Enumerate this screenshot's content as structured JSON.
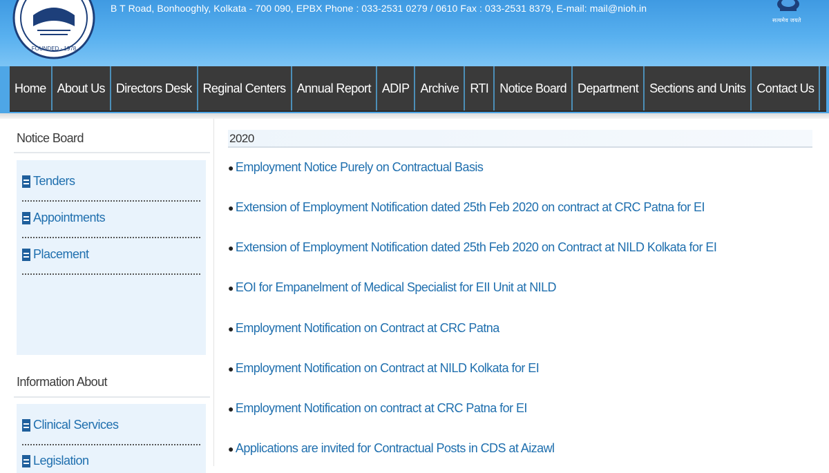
{
  "header": {
    "address": "B T Road, Bonhooghly, Kolkata - 700 090, EPBX Phone : 033-2531 0279 / 0610 Fax : 033-2531 8379, E-mail: mail@nioh.in",
    "logo_icon": "institute-seal-icon",
    "emblem_icon": "government-emblem-icon",
    "logo_text": "FOUNDED - 1978",
    "emblem_text": "सत्यमेव जयते",
    "colors": {
      "header_top": "#3f9ae2",
      "header_bottom": "#7cc4f5"
    }
  },
  "nav": {
    "items": [
      {
        "label": "Home"
      },
      {
        "label": "About Us"
      },
      {
        "label": "Directors Desk"
      },
      {
        "label": "Reginal Centers"
      },
      {
        "label": "Annual Report"
      },
      {
        "label": "ADIP"
      },
      {
        "label": "Archive"
      },
      {
        "label": "RTI"
      },
      {
        "label": "Notice Board"
      },
      {
        "label": "Department"
      },
      {
        "label": "Sections and Units"
      },
      {
        "label": "Contact Us"
      }
    ],
    "colors": {
      "bar": "#3a3a3a",
      "separator": "#4c8fb8"
    }
  },
  "sidebar": {
    "notice_heading": "Notice Board",
    "notice_items": [
      {
        "label": "Tenders",
        "icon": "document-icon"
      },
      {
        "label": "Appointments",
        "icon": "document-icon"
      },
      {
        "label": "Placement",
        "icon": "document-icon"
      }
    ],
    "info_heading": "Information About",
    "info_items": [
      {
        "label": "Clinical Services",
        "icon": "document-icon"
      },
      {
        "label": "Legislation",
        "icon": "document-icon"
      }
    ]
  },
  "main": {
    "year": "2020",
    "notices": [
      "Employment Notice Purely on Contractual Basis",
      "Extension of Employment Notification dated 25th Feb 2020 on contract at CRC Patna for EI",
      "Extension of Employment Notification dated 25th Feb 2020 on Contract at NILD Kolkata for EI",
      "EOI for Empanelment of Medical Specialist for EII Unit at NILD",
      "Employment Notification on Contract at CRC Patna",
      "Employment Notification on Contract at NILD Kolkata for EI",
      "Employment Notification on contract at CRC Patna for EI",
      "Applications are invited for Contractual Posts in CDS at Aizawl"
    ],
    "colors": {
      "link": "#1f6fae"
    }
  }
}
